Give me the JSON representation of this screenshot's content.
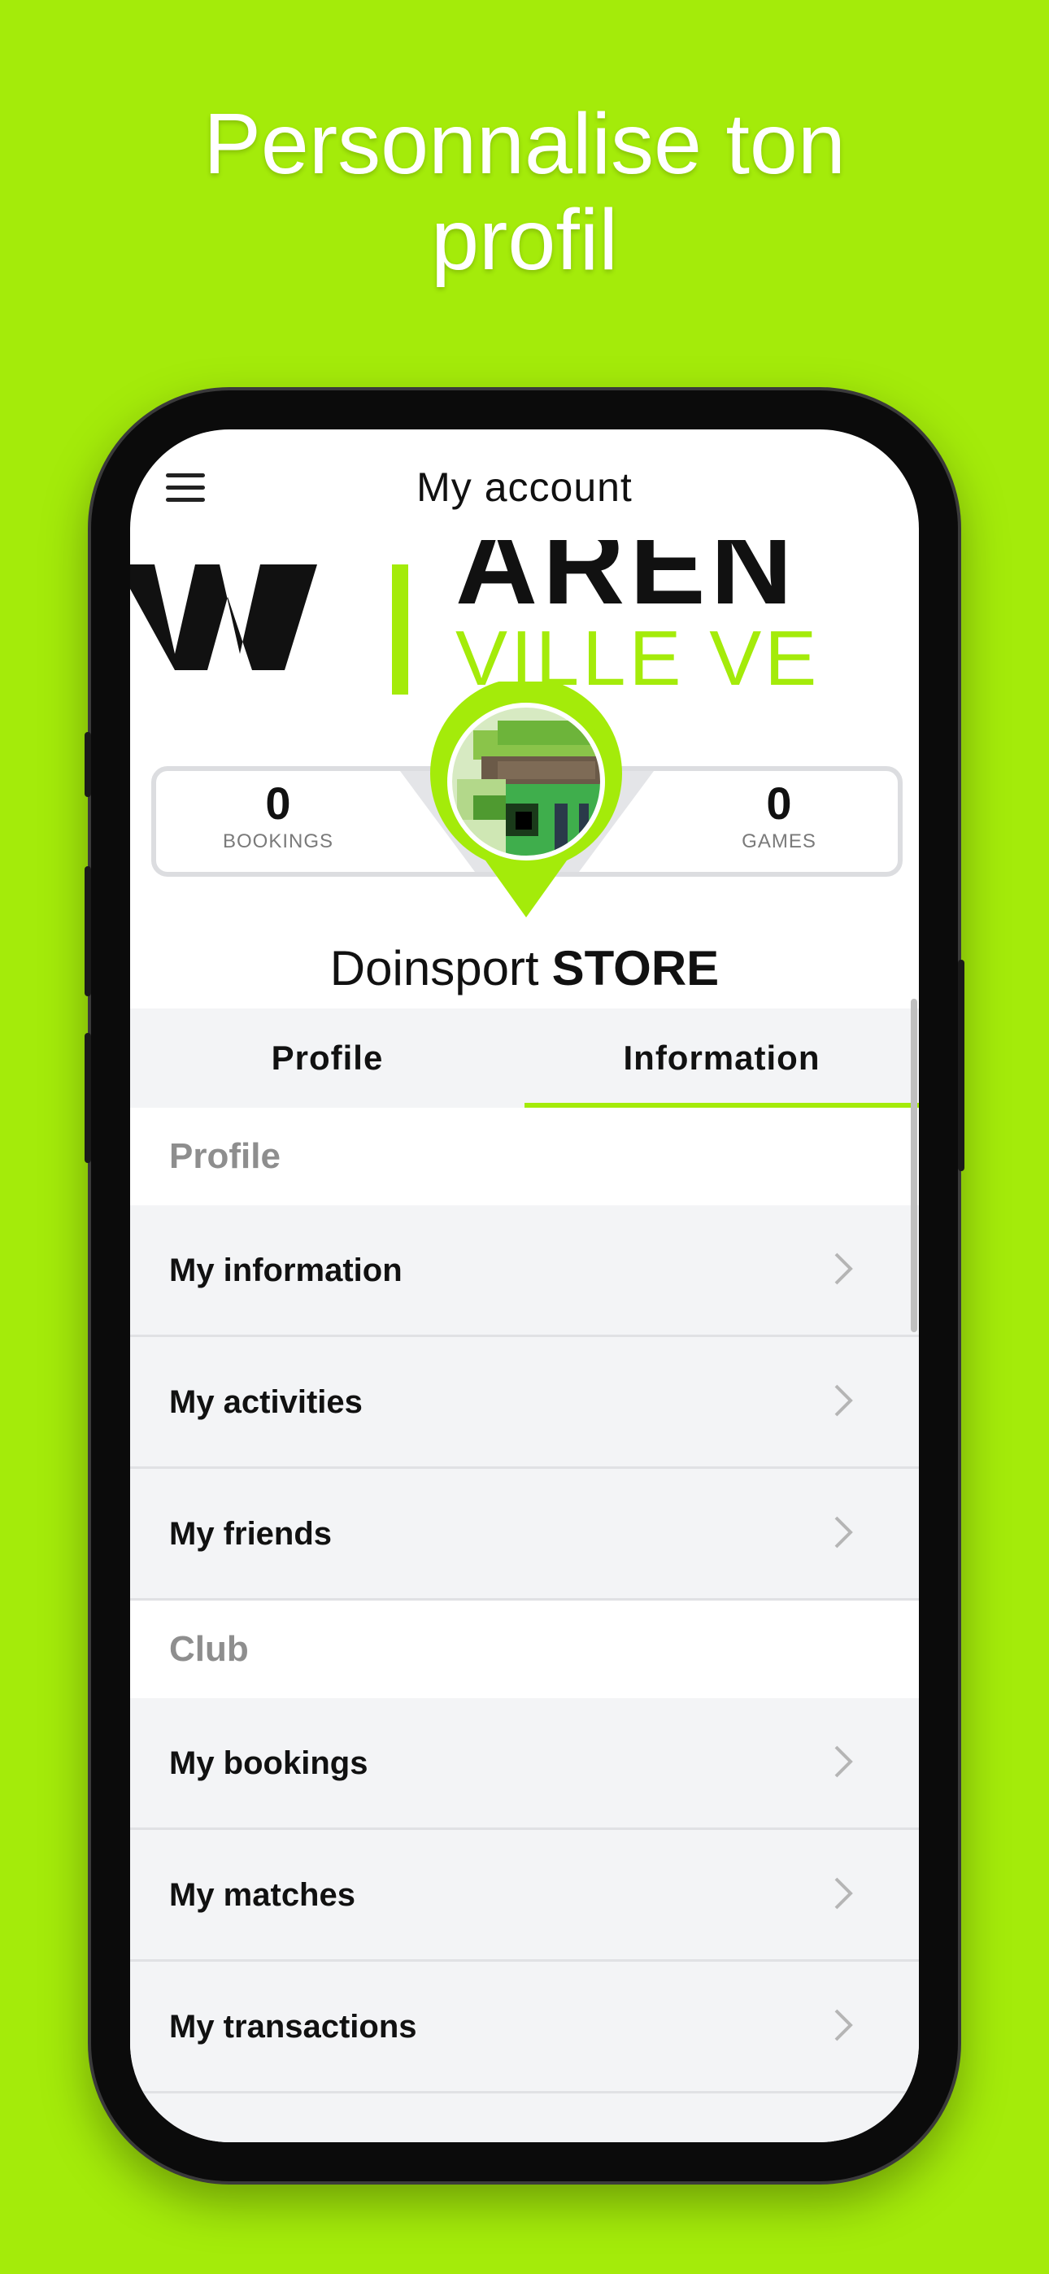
{
  "promo": {
    "line1": "Personnalise ton",
    "line2": "profil"
  },
  "header": {
    "title": "My account"
  },
  "banner": {
    "text_top": "AREN",
    "text_bottom": "VILLE VE"
  },
  "stats": {
    "bookings": {
      "value": "0",
      "label": "BOOKINGS"
    },
    "games": {
      "value": "0",
      "label": "GAMES"
    }
  },
  "user": {
    "first": "Doinsport",
    "last": "STORE"
  },
  "tabs": [
    {
      "label": "Profile",
      "active": false
    },
    {
      "label": "Information",
      "active": true
    }
  ],
  "sections": {
    "profile": {
      "title": "Profile",
      "items": [
        {
          "label": "My information"
        },
        {
          "label": "My activities"
        },
        {
          "label": "My friends"
        }
      ]
    },
    "club": {
      "title": "Club",
      "items": [
        {
          "label": "My bookings"
        },
        {
          "label": "My matches"
        },
        {
          "label": "My transactions"
        }
      ]
    }
  },
  "colors": {
    "accent": "#a4eb0a",
    "surface": "#f3f4f6",
    "text": "#111111",
    "muted": "#8e8e8e"
  },
  "icons": {
    "menu": "hamburger-menu-icon",
    "chevron": "chevron-right-icon"
  }
}
